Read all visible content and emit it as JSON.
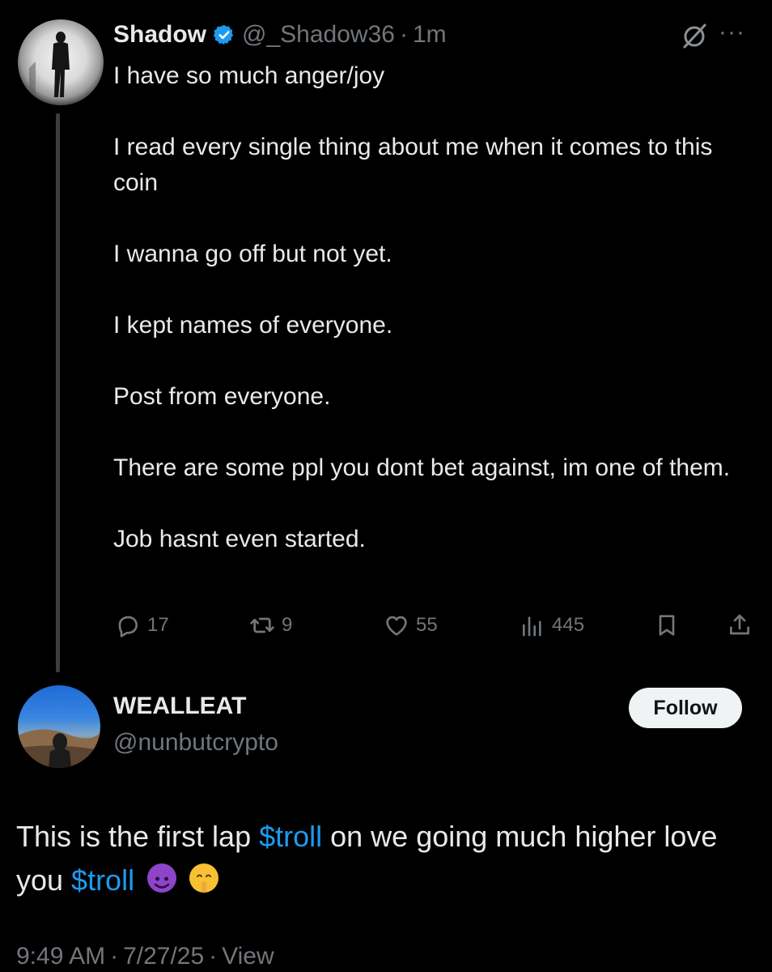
{
  "post": {
    "display_name": "Shadow",
    "handle": "@_Shadow36",
    "separator": "·",
    "age": "1m",
    "more": "···",
    "paragraphs": [
      "I have so much anger/joy",
      "I read every single thing about me when it comes to this coin",
      "I wanna go off but not yet.",
      "I kept names of everyone.",
      "Post from everyone.",
      "There are some ppl you dont bet against, im one of them.",
      "Job hasnt even started."
    ],
    "actions": {
      "replies": "17",
      "reposts": "9",
      "likes": "55",
      "views": "445"
    }
  },
  "reply": {
    "display_name": "WEALLEAT",
    "handle": "@nunbutcrypto",
    "follow_label": "Follow",
    "text_1": "This is the first lap ",
    "cashtag_1": "$troll",
    "text_2": " on we going much higher love you ",
    "cashtag_2": "$troll",
    "time": "9:49 AM",
    "separator": "·",
    "date": "7/27/25",
    "view_label": "View"
  },
  "colors": {
    "background": "#000000",
    "text": "#e7e9ea",
    "muted": "#71767b",
    "cashtag": "#1d9bf0",
    "verified": "#1d9bf0",
    "follow_bg": "#eff3f4"
  },
  "icons": [
    "verified-badge-icon",
    "grok-icon",
    "more-icon",
    "reply-icon",
    "repost-icon",
    "like-icon",
    "views-icon",
    "bookmark-icon",
    "share-icon",
    "smiling-devil-emoji",
    "shushing-face-emoji"
  ]
}
